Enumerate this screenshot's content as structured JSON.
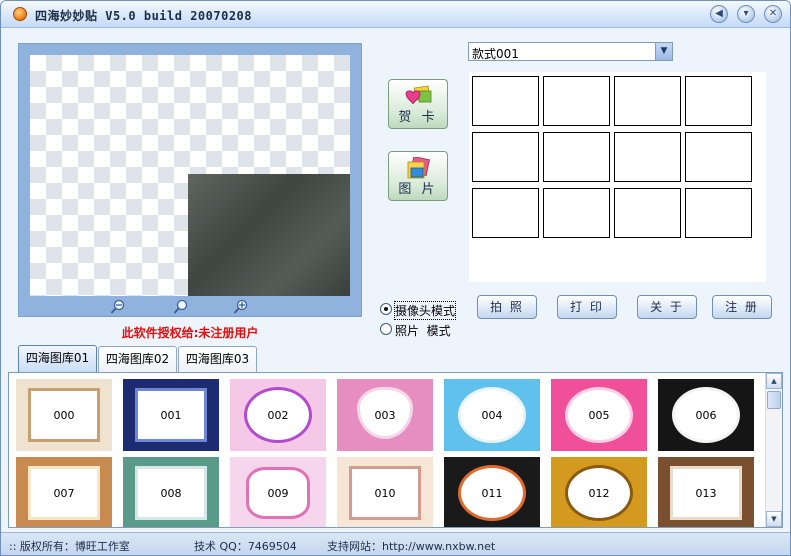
{
  "window": {
    "title": "四海妙妙贴 V5.0 build 20070208",
    "controls": {
      "back": "◀",
      "minimize": "▾",
      "close": "✕"
    }
  },
  "preview": {
    "license_text": "此软件授权给:未注册用户"
  },
  "side_buttons": {
    "card": "贺 卡",
    "picture": "图 片"
  },
  "style_select": {
    "value": "款式001"
  },
  "mode": {
    "camera": "摄像头模式",
    "photo": "照片  模式",
    "selected": "camera"
  },
  "actions": {
    "shoot": "拍 照",
    "print": "打 印",
    "about": "关 于",
    "register": "注 册"
  },
  "tabs": [
    {
      "label": "四海图库01",
      "active": true
    },
    {
      "label": "四海图库02",
      "active": false
    },
    {
      "label": "四海图库03",
      "active": false
    }
  ],
  "gallery": [
    {
      "num": "000",
      "bg": "#efe3cf",
      "frame": "#c8a070",
      "shape": "rect"
    },
    {
      "num": "001",
      "bg": "#1d2b70",
      "frame": "#6f86d6",
      "shape": "rect"
    },
    {
      "num": "002",
      "bg": "#f6c8e8",
      "frame": "#b24ad0",
      "shape": "ellipse"
    },
    {
      "num": "003",
      "bg": "#e78ec0",
      "frame": "#f4d8ea",
      "shape": "heart"
    },
    {
      "num": "004",
      "bg": "#5fc1ec",
      "frame": "#e8f3ff",
      "shape": "ellipse"
    },
    {
      "num": "005",
      "bg": "#f04f9a",
      "frame": "#ffd0e6",
      "shape": "ellipse"
    },
    {
      "num": "006",
      "bg": "#151515",
      "frame": "#f4f4f4",
      "shape": "ellipse"
    },
    {
      "num": "007",
      "bg": "#c98a50",
      "frame": "#f4e6c6",
      "shape": "rect"
    },
    {
      "num": "008",
      "bg": "#5a9a88",
      "frame": "#d4e8ec",
      "shape": "rect"
    },
    {
      "num": "009",
      "bg": "#f6d6ec",
      "frame": "#e070b8",
      "shape": "diamond"
    },
    {
      "num": "010",
      "bg": "#f6e6d6",
      "frame": "#d69a8e",
      "shape": "rect"
    },
    {
      "num": "011",
      "bg": "#1a1a1a",
      "frame": "#e26a2a",
      "shape": "ellipse"
    },
    {
      "num": "012",
      "bg": "#d49a20",
      "frame": "#8a5a10",
      "shape": "ellipse"
    },
    {
      "num": "013",
      "bg": "#7a5030",
      "frame": "#e8dcc8",
      "shape": "rect"
    }
  ],
  "status": {
    "copyright": ":: 版权所有：博旺工作室",
    "qq": "技术 QQ：7469504",
    "website": "支持网站：http://www.nxbw.net"
  }
}
